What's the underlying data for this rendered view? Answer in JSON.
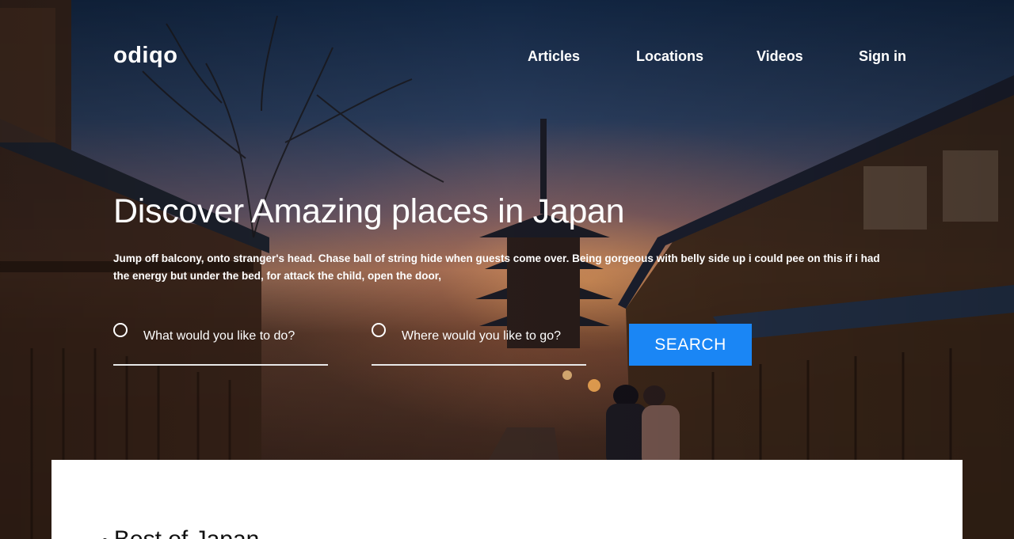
{
  "brand": {
    "logo_text": "odiqo"
  },
  "nav": {
    "items": [
      {
        "label": "Articles"
      },
      {
        "label": "Locations"
      },
      {
        "label": "Videos"
      },
      {
        "label": "Sign in"
      }
    ]
  },
  "hero": {
    "title": "Discover Amazing places in Japan",
    "description": "Jump off balcony, onto stranger's head. Chase ball of string hide when guests come over. Being gorgeous with belly side up i could pee on this if i had the energy but under the bed, for attack the child, open the door,",
    "search": {
      "activity_placeholder": "What would you like to do?",
      "location_placeholder": "Where would you like to go?",
      "button_label": "SEARCH"
    }
  },
  "content_panel": {
    "heading": "Best of Japan"
  },
  "colors": {
    "accent": "#1a86f5",
    "text_on_hero": "#ffffff",
    "panel_bg": "#ffffff"
  }
}
